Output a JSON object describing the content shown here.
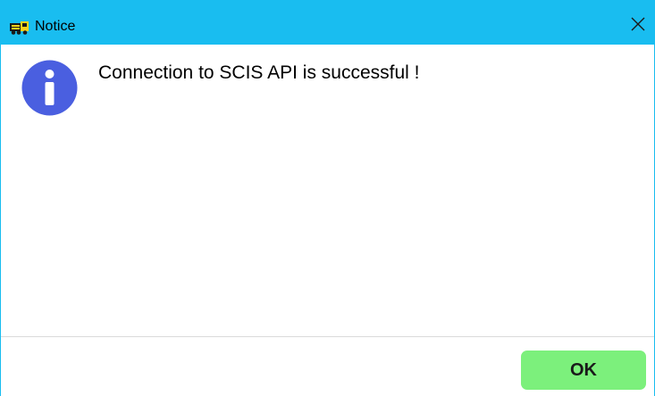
{
  "window": {
    "title": "Notice",
    "icon": "locomotive-app-icon",
    "close_icon": "close-icon",
    "titlebar_color": "#19bdf0"
  },
  "content": {
    "icon": "info-icon",
    "icon_color": "#4a5fe0",
    "message": "Connection to SCIS API is successful !"
  },
  "footer": {
    "ok_label": "OK",
    "ok_color": "#7cf07c"
  }
}
